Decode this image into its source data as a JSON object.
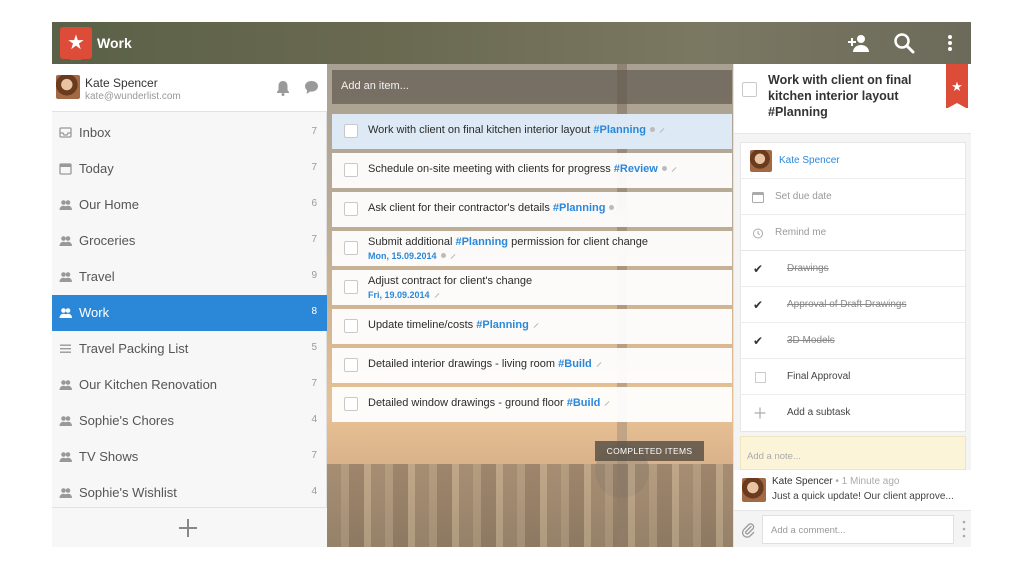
{
  "header": {
    "list_title": "Work",
    "icons": {
      "logo": "star-icon",
      "add_member": "add-member-icon",
      "search": "search-icon",
      "more": "more-vertical-icon"
    }
  },
  "user": {
    "name": "Kate Spencer",
    "email": "kate@wunderlist.com"
  },
  "sidebar": {
    "items": [
      {
        "label": "Inbox",
        "count": "7",
        "icon": "inbox-icon"
      },
      {
        "label": "Today",
        "count": "7",
        "icon": "calendar-icon"
      },
      {
        "label": "Our Home",
        "count": "6",
        "icon": "shared-list-icon"
      },
      {
        "label": "Groceries",
        "count": "7",
        "icon": "shared-list-icon"
      },
      {
        "label": "Travel",
        "count": "9",
        "icon": "shared-list-icon"
      },
      {
        "label": "Work",
        "count": "8",
        "icon": "shared-list-icon",
        "active": true
      },
      {
        "label": "Travel Packing List",
        "count": "5",
        "icon": "list-icon"
      },
      {
        "label": "Our Kitchen Renovation",
        "count": "7",
        "icon": "shared-list-icon"
      },
      {
        "label": "Sophie's Chores",
        "count": "4",
        "icon": "shared-list-icon"
      },
      {
        "label": "TV Shows",
        "count": "7",
        "icon": "shared-list-icon"
      },
      {
        "label": "Sophie's Wishlist",
        "count": "4",
        "icon": "shared-list-icon"
      }
    ]
  },
  "main": {
    "add_placeholder": "Add an item...",
    "tasks": [
      {
        "title": "Work with client on final kitchen interior layout",
        "tag": "#Planning",
        "date": "",
        "selected": true
      },
      {
        "title": "Schedule on-site meeting with clients for progress",
        "tag": "#Review",
        "date": ""
      },
      {
        "title": "Ask client for their contractor's details",
        "tag": "#Planning",
        "date": ""
      },
      {
        "title": "Submit additional",
        "tag": "#Planning",
        "title_after": "permission for client change",
        "date": "Mon, 15.09.2014"
      },
      {
        "title": "Adjust contract for client's change",
        "tag": "",
        "date": "Fri, 19.09.2014"
      },
      {
        "title": "Update timeline/costs",
        "tag": "#Planning",
        "date": ""
      },
      {
        "title": "Detailed interior drawings - living room",
        "tag": "#Build",
        "date": ""
      },
      {
        "title": "Detailed window drawings - ground floor",
        "tag": "#Build",
        "date": ""
      }
    ],
    "completed_label": "COMPLETED ITEMS"
  },
  "detail": {
    "title": "Work with client on final kitchen interior layout #Planning",
    "assignee": "Kate Spencer",
    "due_placeholder": "Set due date",
    "remind_placeholder": "Remind me",
    "subtasks": [
      {
        "label": "Drawings",
        "done": true
      },
      {
        "label": "Approval of Draft Drawings",
        "done": true
      },
      {
        "label": "3D Models",
        "done": true
      },
      {
        "label": "Final Approval",
        "done": false
      }
    ],
    "add_subtask": "Add a subtask",
    "note_placeholder": "Add a note...",
    "comment": {
      "author": "Kate Spencer",
      "time": "• 1 Minute ago",
      "text": "Just a quick update! Our client approve..."
    },
    "comment_placeholder": "Add a comment...",
    "accent": "#2b88d9",
    "brand": "#dd4b39"
  }
}
